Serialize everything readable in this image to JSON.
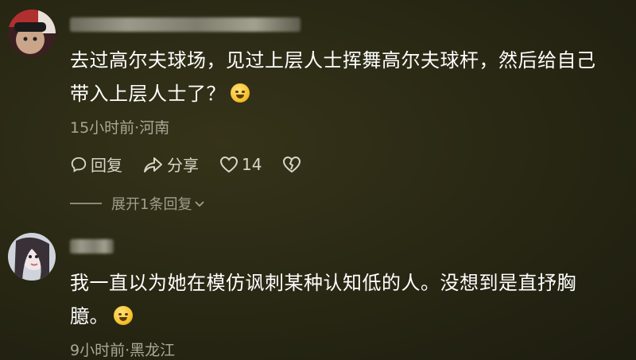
{
  "comments": [
    {
      "text_line1": "去过高尔夫球场，见过上层人士挥舞高尔夫球杆，然后给自己",
      "text_line2": "带入上层人士了？",
      "meta": "15小时前·河南",
      "reply_label": "回复",
      "share_label": "分享",
      "like_count": "14",
      "expand_label": "展开1条回复"
    },
    {
      "text_line1": "我一直以为她在模仿讽刺某种认知低的人。没想到是直抒胸",
      "text_line2": "臆。",
      "meta": "9小时前·黑龙江"
    }
  ],
  "icons": [
    "reply-icon",
    "share-icon",
    "heart-icon",
    "broken-heart-icon",
    "chevron-down-icon"
  ]
}
